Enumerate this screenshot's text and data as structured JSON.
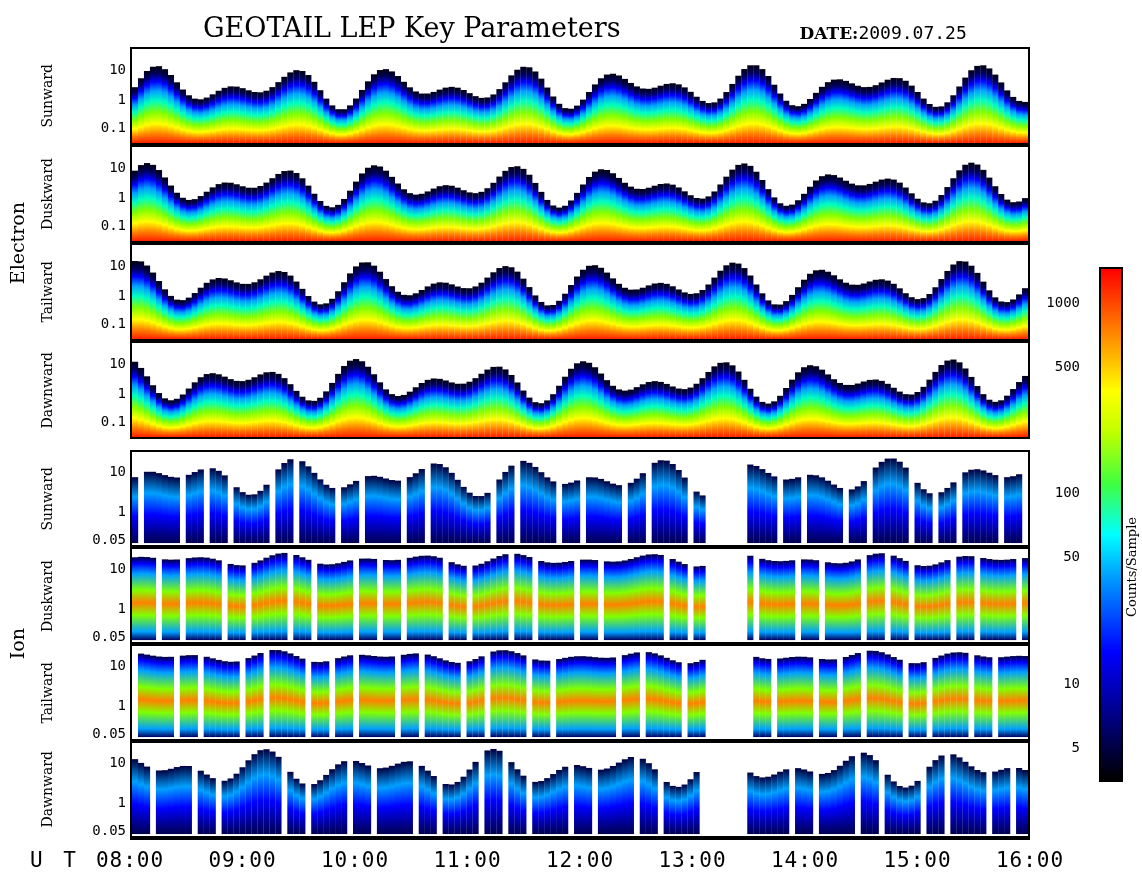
{
  "title": "GEOTAIL LEP Key Parameters",
  "date": {
    "label": "DATE:",
    "value": "2009.07.25"
  },
  "groups": [
    {
      "name": "Electron",
      "kind": "electron",
      "panels": [
        {
          "direction": "Sunward",
          "yticks": [
            "10",
            "1",
            "0.1"
          ]
        },
        {
          "direction": "Duskward",
          "yticks": [
            "10",
            "1",
            "0.1"
          ]
        },
        {
          "direction": "Tailward",
          "yticks": [
            "10",
            "1",
            "0.1"
          ]
        },
        {
          "direction": "Dawnward",
          "yticks": [
            "10",
            "1",
            "0.1"
          ]
        }
      ]
    },
    {
      "name": "Ion",
      "kind": "ion",
      "panels": [
        {
          "direction": "Sunward",
          "yticks": [
            "10",
            "1",
            "0.05"
          ]
        },
        {
          "direction": "Duskward",
          "yticks": [
            "10",
            "1",
            "0.05"
          ]
        },
        {
          "direction": "Tailward",
          "yticks": [
            "10",
            "1",
            "0.05"
          ]
        },
        {
          "direction": "Dawnward",
          "yticks": [
            "10",
            "1",
            "0.05"
          ]
        }
      ]
    }
  ],
  "time_axis": {
    "label": "U T",
    "ticks": [
      "08:00",
      "09:00",
      "10:00",
      "11:00",
      "12:00",
      "13:00",
      "14:00",
      "15:00",
      "16:00"
    ]
  },
  "colorbar": {
    "label": "Counts/Sample",
    "ticks": [
      "1000",
      "500",
      "100",
      "50",
      "10",
      "5"
    ]
  }
}
